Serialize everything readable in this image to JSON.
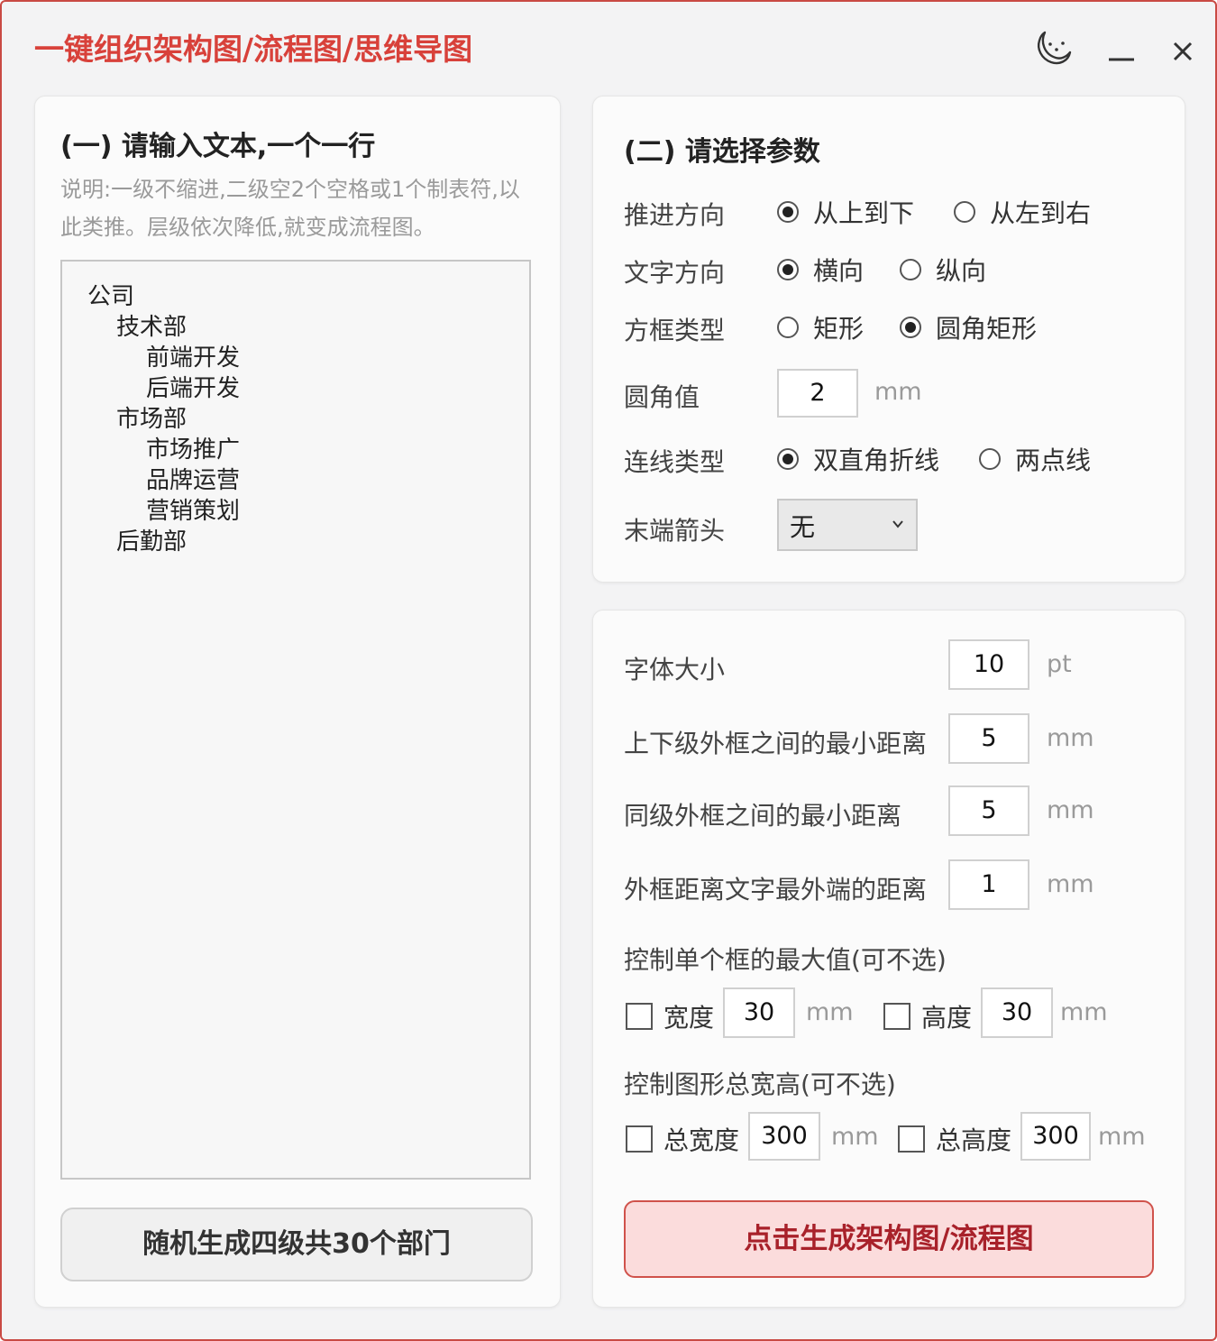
{
  "app": {
    "title": "一键组织架构图/流程图/思维导图"
  },
  "input_panel": {
    "title": "(一) 请输入文本,一个一行",
    "note": "说明:一级不缩进,二级空2个空格或1个制表符,以此类推。层级依次降低,就变成流程图。",
    "lines": {
      "l0": "公司",
      "l1": "技术部",
      "l2": "前端开发",
      "l3": "后端开发",
      "l4": "市场部",
      "l5": "市场推广",
      "l6": "品牌运营",
      "l7": "营销策划",
      "l8": "后勤部"
    },
    "random_button": "随机生成四级共30个部门"
  },
  "params": {
    "title": "(二) 请选择参数",
    "direction": {
      "label": "推进方向",
      "opt1": "从上到下",
      "opt2": "从左到右",
      "selected": "从上到下"
    },
    "text_direction": {
      "label": "文字方向",
      "opt1": "横向",
      "opt2": "纵向",
      "selected": "横向"
    },
    "box_type": {
      "label": "方框类型",
      "opt1": "矩形",
      "opt2": "圆角矩形",
      "selected": "圆角矩形"
    },
    "corner": {
      "label": "圆角值",
      "value": "2",
      "unit": "mm"
    },
    "line_type": {
      "label": "连线类型",
      "opt1": "双直角折线",
      "opt2": "两点线",
      "selected": "双直角折线"
    },
    "arrow": {
      "label": "末端箭头",
      "value": "无"
    }
  },
  "size": {
    "font": {
      "label": "字体大小",
      "value": "10",
      "unit": "pt"
    },
    "vertical_gap": {
      "label": "上下级外框之间的最小距离",
      "value": "5",
      "unit": "mm"
    },
    "sibling_gap": {
      "label": "同级外框之间的最小距离",
      "value": "5",
      "unit": "mm"
    },
    "padding": {
      "label": "外框距离文字最外端的距离",
      "value": "1",
      "unit": "mm"
    },
    "max_box": {
      "label": "控制单个框的最大值(可不选)",
      "width_label": "宽度",
      "width_value": "30",
      "width_unit": "mm",
      "width_checked": false,
      "height_label": "高度",
      "height_value": "30",
      "height_unit": "mm",
      "height_checked": false
    },
    "total": {
      "label": "控制图形总宽高(可不选)",
      "width_label": "总宽度",
      "width_value": "300",
      "width_unit": "mm",
      "width_checked": false,
      "height_label": "总高度",
      "height_value": "300",
      "height_unit": "mm",
      "height_checked": false
    },
    "generate_button": "点击生成架构图/流程图"
  },
  "colors": {
    "accent": "#d8413a",
    "generate_bg": "#fbdcdc",
    "generate_text": "#a8212a"
  },
  "icons": [
    "moon-icon",
    "minimize-icon",
    "close-icon",
    "chevron-down-icon"
  ]
}
